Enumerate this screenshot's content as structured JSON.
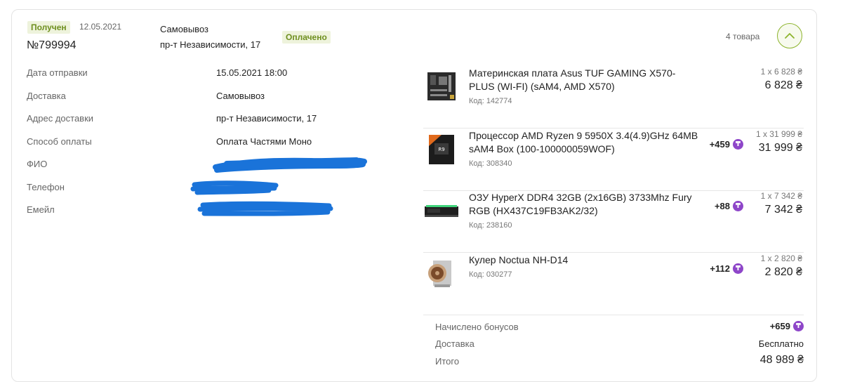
{
  "order": {
    "status_badge": "Получен",
    "date": "12.05.2021",
    "number": "№799994",
    "delivery_type": "Самовывоз",
    "delivery_address": "пр-т Независимости, 17",
    "payment_badge": "Оплачено",
    "items_count": "4 товара"
  },
  "details": [
    {
      "label": "Дата отправки",
      "value": "15.05.2021 18:00"
    },
    {
      "label": "Доставка",
      "value": "Самовывоз"
    },
    {
      "label": "Адрес доставки",
      "value": "пр-т Независимости, 17"
    },
    {
      "label": "Способ оплаты",
      "value": "Оплата Частями Моно"
    },
    {
      "label": "ФИО",
      "value": ""
    },
    {
      "label": "Телефон",
      "value": ""
    },
    {
      "label": "Емейл",
      "value": ""
    }
  ],
  "products": [
    {
      "name": "Материнская плата Asus TUF GAMING X570-PLUS (WI-FI) (sAM4, AMD X570)",
      "code": "Код: 142774",
      "bonus": "",
      "qty": "1 x 6 828 ₴",
      "price": "6 828 ₴"
    },
    {
      "name": "Процессор AMD Ryzen 9 5950X 3.4(4.9)GHz 64MB sAM4 Box (100-100000059WOF)",
      "code": "Код: 308340",
      "bonus": "+459",
      "qty": "1 x 31 999 ₴",
      "price": "31 999 ₴"
    },
    {
      "name": "ОЗУ HyperX DDR4 32GB (2x16GB) 3733Mhz Fury RGB (HX437C19FB3AK2/32)",
      "code": "Код: 238160",
      "bonus": "+88",
      "qty": "1 x 7 342 ₴",
      "price": "7 342 ₴"
    },
    {
      "name": "Кулер Noctua NH-D14",
      "code": "Код: 030277",
      "bonus": "+112",
      "qty": "1 x 2 820 ₴",
      "price": "2 820 ₴"
    }
  ],
  "summary": {
    "bonus_label": "Начислено бонусов",
    "bonus_value": "+659",
    "delivery_label": "Доставка",
    "delivery_value": "Бесплатно",
    "total_label": "Итого",
    "total_value": "48 989 ₴"
  },
  "colors": {
    "accent_green": "#8db42d",
    "badge_bg": "#eef3dc",
    "bonus_purple": "#8e46c9",
    "redaction_blue": "#1a73d9"
  },
  "icons": {
    "toggle": "chevron-up-icon",
    "bonus": "bonus-coin-icon"
  }
}
